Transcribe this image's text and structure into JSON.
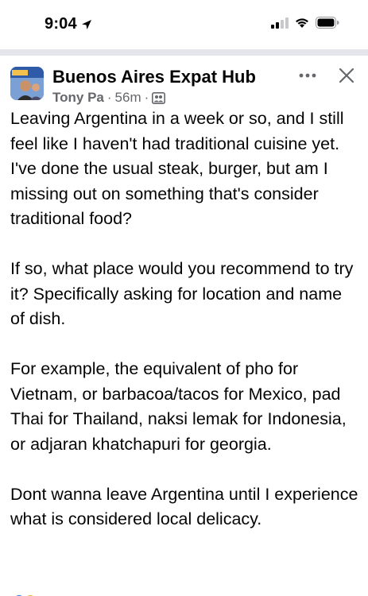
{
  "status_bar": {
    "time": "9:04",
    "icons": [
      "location-arrow-icon",
      "signal-icon",
      "wifi-icon",
      "battery-icon"
    ]
  },
  "post": {
    "group_name": "Buenos Aires Expat Hub",
    "author": "Tony Pa",
    "separator": "·",
    "time_ago": "56m",
    "paragraphs": [
      "Leaving Argentina in a week or so, and I still feel like I haven't had traditional cuisine yet. I've done the usual steak, burger, but am I missing out on something that's consider traditional food?",
      "If so, what place would you recommend to try it? Specifically asking for location and name of dish.",
      "For example, the equivalent of pho for Vietnam, or barbacoa/tacos for Mexico, pad Thai for Thailand, naksi lemak for Indonesia, or adjaran khatchapuri for georgia.",
      "Dont wanna leave Argentina until I experience what is considered local delicacy."
    ]
  },
  "colors": {
    "text": "#050505",
    "meta": "#65676b",
    "divider": "#e4e6eb"
  }
}
